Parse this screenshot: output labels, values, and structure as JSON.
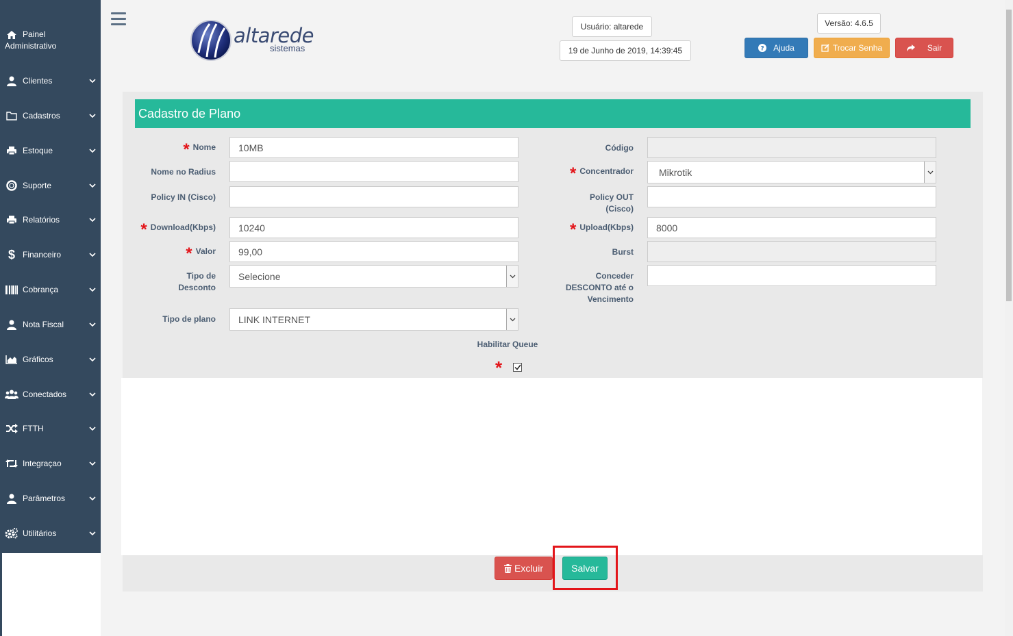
{
  "sidebar": {
    "painel_line1": "Painel",
    "painel_line2": "Administrativo",
    "items": [
      {
        "label": "Clientes"
      },
      {
        "label": "Cadastros"
      },
      {
        "label": "Estoque"
      },
      {
        "label": "Suporte"
      },
      {
        "label": "Relatórios"
      },
      {
        "label": "Financeiro"
      },
      {
        "label": "Cobrança"
      },
      {
        "label": "Nota Fiscal"
      },
      {
        "label": "Gráficos"
      },
      {
        "label": "Conectados"
      },
      {
        "label": "FTTH"
      },
      {
        "label": "Integraçao"
      },
      {
        "label": "Parâmetros"
      },
      {
        "label": "Utilitários"
      }
    ]
  },
  "header": {
    "logo_text": "altarede",
    "logo_sub": "sistemas",
    "user": "Usuário: altarede",
    "datetime": "19 de Junho de 2019, 14:39:45",
    "version": "Versão: 4.6.5",
    "help_label": "Ajuda",
    "change_password_label": "Trocar Senha",
    "logout_label": "Sair"
  },
  "form": {
    "title": "Cadastro de Plano",
    "nome_label": "Nome",
    "nome_value": "10MB",
    "radius_label": "Nome no Radius",
    "radius_value": "",
    "policy_in_label": "Policy IN (Cisco)",
    "policy_in_value": "",
    "download_label": "Download(Kbps)",
    "download_value": "10240",
    "valor_label": "Valor",
    "valor_value": "99,00",
    "tipo_desconto_line1": "Tipo de",
    "tipo_desconto_line2": "Desconto",
    "tipo_desconto_value": "Selecione",
    "tipo_plano_label": "Tipo de plano",
    "tipo_plano_value": "LINK INTERNET",
    "codigo_label": "Código",
    "codigo_value": "",
    "concentrador_label": "Concentrador",
    "concentrador_value": "Mikrotik",
    "policy_out_line1": "Policy OUT",
    "policy_out_line2": "(Cisco)",
    "policy_out_value": "",
    "upload_label": "Upload(Kbps)",
    "upload_value": "8000",
    "burst_label": "Burst",
    "burst_value": "",
    "desconto_line1": "Conceder",
    "desconto_line2": "DESCONTO até o",
    "desconto_line3": "Vencimento",
    "desconto_value": "",
    "queue_label": "Habilitar Queue",
    "queue_checked": true
  },
  "actions": {
    "delete_label": "Excluir",
    "save_label": "Salvar"
  },
  "colors": {
    "sidebar": "#34495e",
    "title_bar": "#26b99a",
    "help": "#337ab7",
    "change_password": "#f0ad4e",
    "logout": "#d9534f",
    "save": "#26b99a",
    "delete": "#d9534f",
    "required": "#e3151a"
  }
}
